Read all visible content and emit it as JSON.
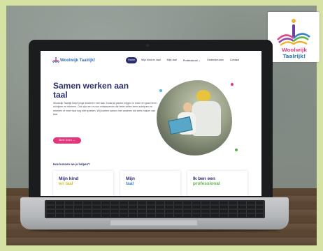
{
  "logo": {
    "text_part1": "Woolwijk",
    "text_part2": "Taalrijk!"
  },
  "website": {
    "brand": "Woolwijk Taalrijk!",
    "nav": [
      "Home",
      "Mijn kind en taal",
      "Mijn taal",
      "Professional ⌄",
      "Ondersteunen",
      "Contact"
    ],
    "hero_title": "Samen werken aan taal",
    "hero_text": "Woolwijk Taalrijk helpt jonge kinderen met taal. Zodat zij plezier krijgen in lezen en goed leren schrijven en rekenen. Ook zijn we er voor volwassenen die beter willen leren schrijven en rekenen of meer taal nog niet spreken. Wij zoeken samen met anderen die werk maken van taal.",
    "hero_button": "Meer lezen →",
    "help_title": "Hoe kunnen we je helpen?",
    "cards": [
      {
        "line1": "Mijn kind",
        "line2": "en taal"
      },
      {
        "line1": "Mijn",
        "line2": "taal"
      },
      {
        "line1": "Ik ben een",
        "line2": "professional"
      }
    ]
  },
  "colors": {
    "brand_navy": "#2a2f6e",
    "brand_pink": "#e2367d",
    "brand_blue": "#2f7fb8",
    "accent_yellow": "#d4c12c"
  }
}
